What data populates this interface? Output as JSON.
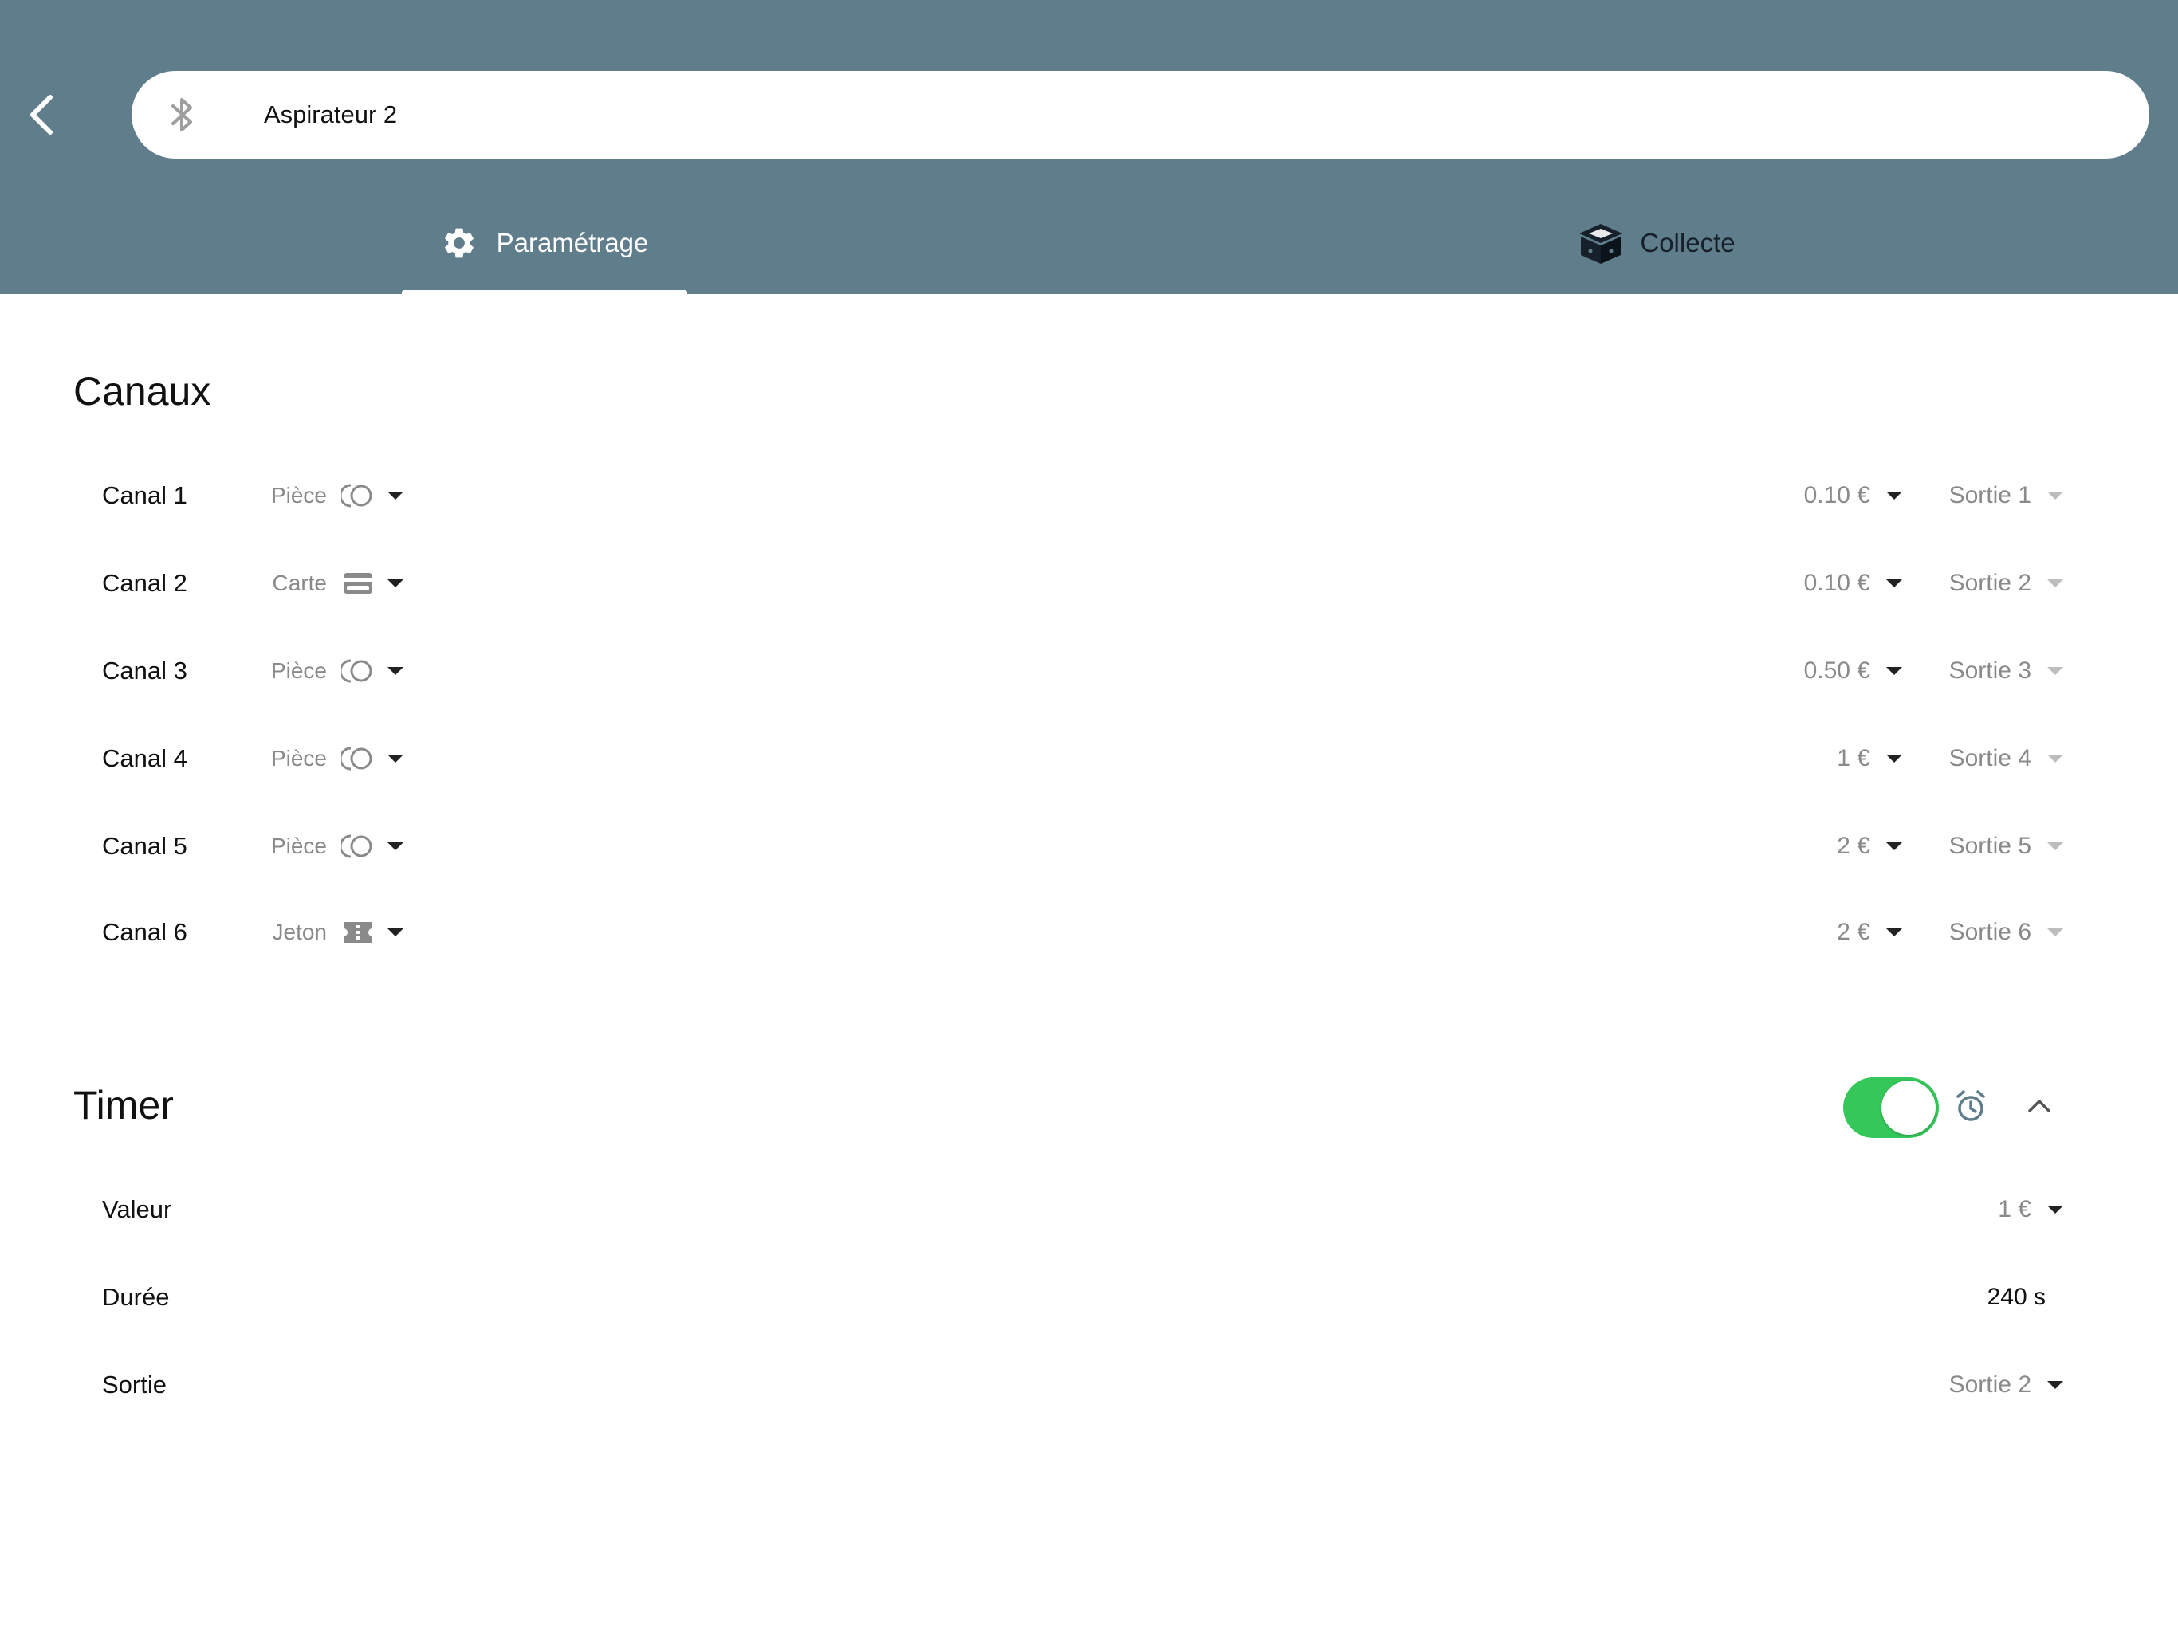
{
  "header": {
    "title": "Aspirateur 2",
    "icons": {
      "back": "chevron-left-icon",
      "bluetooth": "bluetooth-icon"
    },
    "color": "#607d8b"
  },
  "tabs": [
    {
      "label": "Paramétrage",
      "icon": "gear-icon",
      "active": true
    },
    {
      "label": "Collecte",
      "icon": "cash-box-icon",
      "active": false
    }
  ],
  "channels": {
    "title": "Canaux",
    "rows": [
      {
        "name": "Canal 1",
        "type": "Pièce",
        "type_icon": "coin-icon",
        "amount": "0.10 €",
        "output": "Sortie 1"
      },
      {
        "name": "Canal 2",
        "type": "Carte",
        "type_icon": "card-icon",
        "amount": "0.10 €",
        "output": "Sortie 2"
      },
      {
        "name": "Canal 3",
        "type": "Pièce",
        "type_icon": "coin-icon",
        "amount": "0.50 €",
        "output": "Sortie 3"
      },
      {
        "name": "Canal 4",
        "type": "Pièce",
        "type_icon": "coin-icon",
        "amount": "1 €",
        "output": "Sortie 4"
      },
      {
        "name": "Canal 5",
        "type": "Pièce",
        "type_icon": "coin-icon",
        "amount": "2 €",
        "output": "Sortie 5"
      },
      {
        "name": "Canal 6",
        "type": "Jeton",
        "type_icon": "token-icon",
        "amount": "2 €",
        "output": "Sortie 6"
      }
    ]
  },
  "timer": {
    "title": "Timer",
    "enabled": true,
    "toggle_color": "#34c759",
    "rows": {
      "value_label": "Valeur",
      "value": "1 €",
      "duration_label": "Durée",
      "duration": "240 s",
      "output_label": "Sortie",
      "output": "Sortie 2"
    }
  }
}
